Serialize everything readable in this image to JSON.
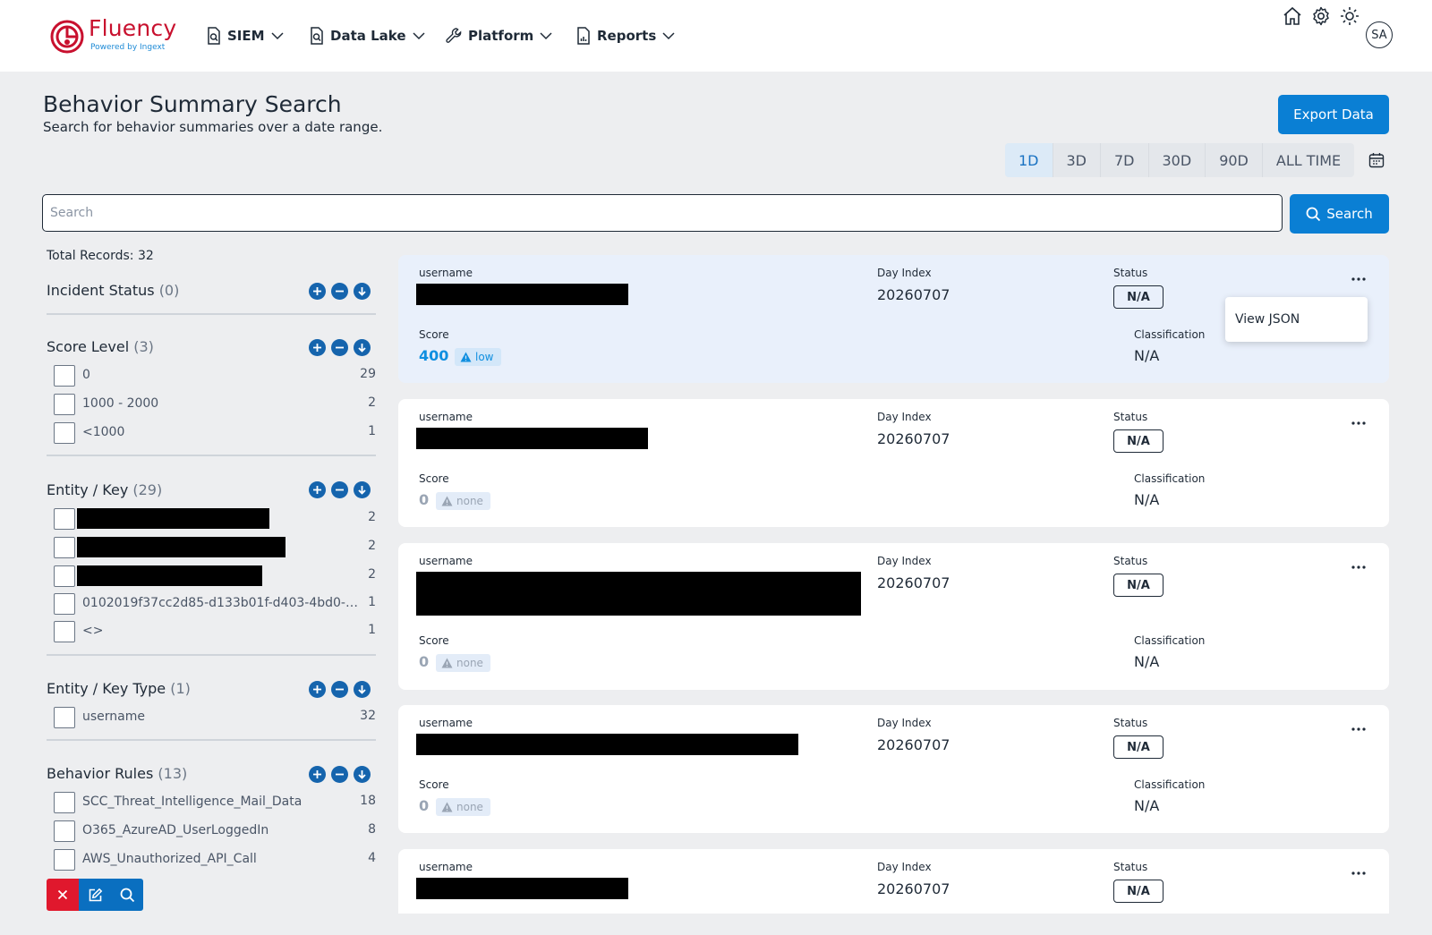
{
  "brand": {
    "name": "Fluency",
    "tagline": "Powered by Ingext"
  },
  "nav": {
    "items": [
      "SIEM",
      "Data Lake",
      "Platform",
      "Reports"
    ]
  },
  "user": {
    "initials": "SA"
  },
  "page": {
    "title": "Behavior Summary Search",
    "subtitle": "Search for behavior summaries over a date range."
  },
  "actions": {
    "export": "Export Data",
    "search": "Search"
  },
  "ranges": {
    "options": [
      "1D",
      "3D",
      "7D",
      "30D",
      "90D",
      "ALL TIME"
    ],
    "selected": "1D"
  },
  "search": {
    "placeholder": "Search",
    "value": ""
  },
  "facets": {
    "total": "Total Records: 32",
    "groups": [
      {
        "title": "Incident Status",
        "count": "(0)",
        "items": []
      },
      {
        "title": "Score Level",
        "count": "(3)",
        "items": [
          {
            "label": "0",
            "count": "29"
          },
          {
            "label": "1000 - 2000",
            "count": "2"
          },
          {
            "label": "<1000",
            "count": "1"
          }
        ]
      },
      {
        "title": "Entity / Key",
        "count": "(29)",
        "items": [
          {
            "label": "",
            "count": "2"
          },
          {
            "label": "",
            "count": "2"
          },
          {
            "label": "",
            "count": "2"
          },
          {
            "label": "0102019f37cc2d85-d133b01f-d403-4bd0-…",
            "count": "1"
          },
          {
            "label": "<>",
            "count": "1"
          }
        ]
      },
      {
        "title": "Entity / Key Type",
        "count": "(1)",
        "items": [
          {
            "label": "username",
            "count": "32"
          }
        ]
      },
      {
        "title": "Behavior Rules",
        "count": "(13)",
        "items": [
          {
            "label": "SCC_Threat_Intelligence_Mail_Data",
            "count": "18"
          },
          {
            "label": "O365_AzureAD_UserLoggedIn",
            "count": "8"
          },
          {
            "label": "AWS_Unauthorized_API_Call",
            "count": "4"
          }
        ]
      }
    ]
  },
  "card_labels": {
    "username": "username",
    "day_index": "Day Index",
    "status": "Status",
    "score": "Score",
    "classification": "Classification"
  },
  "results": [
    {
      "day_index": "20260707",
      "status": "N/A",
      "score": "400",
      "severity": "low",
      "classification": "N/A"
    },
    {
      "day_index": "20260707",
      "status": "N/A",
      "score": "0",
      "severity": "none",
      "classification": "N/A"
    },
    {
      "day_index": "20260707",
      "status": "N/A",
      "score": "0",
      "severity": "none",
      "classification": "N/A"
    },
    {
      "day_index": "20260707",
      "status": "N/A",
      "score": "0",
      "severity": "none",
      "classification": "N/A"
    },
    {
      "day_index": "20260707",
      "status": "N/A"
    }
  ],
  "context_menu": {
    "items": [
      "View JSON"
    ]
  },
  "colors": {
    "primary": "#0a7fd4",
    "brand": "#c8102e",
    "danger": "#e0182d",
    "score_low": "#0f8fe0",
    "score_none": "#9aa5b4"
  }
}
